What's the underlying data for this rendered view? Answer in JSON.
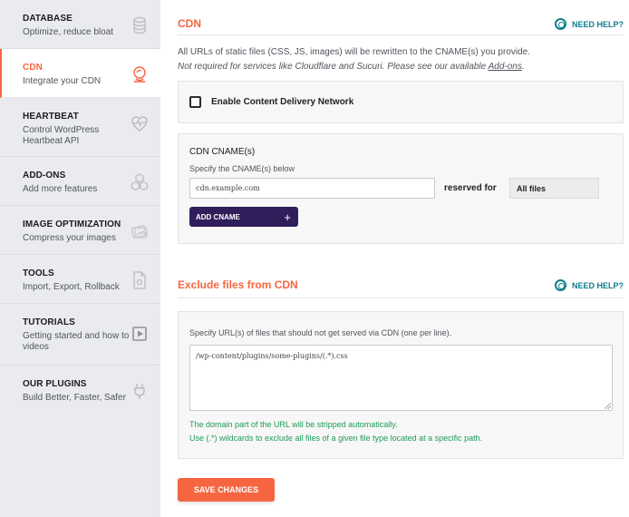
{
  "sidebar": {
    "items": [
      {
        "title": "DATABASE",
        "desc": "Optimize, reduce bloat",
        "icon": "database-icon"
      },
      {
        "title": "CDN",
        "desc": "Integrate your CDN",
        "icon": "cdn-icon"
      },
      {
        "title": "HEARTBEAT",
        "desc": "Control WordPress Heartbeat API",
        "icon": "heartbeat-icon"
      },
      {
        "title": "ADD-ONS",
        "desc": "Add more features",
        "icon": "addons-icon"
      },
      {
        "title": "IMAGE OPTIMIZATION",
        "desc": "Compress your images",
        "icon": "image-icon"
      },
      {
        "title": "TOOLS",
        "desc": "Import, Export, Rollback",
        "icon": "tools-icon"
      },
      {
        "title": "TUTORIALS",
        "desc": "Getting started and how to videos",
        "icon": "play-icon"
      },
      {
        "title": "OUR PLUGINS",
        "desc": "Build Better, Faster, Safer",
        "icon": "plug-icon"
      }
    ]
  },
  "cdn": {
    "title": "CDN",
    "help": "NEED HELP?",
    "intro_line1": "All URLs of static files (CSS, JS, images) will be rewritten to the CNAME(s) you provide.",
    "intro_line2_prefix": "Not required for services like Cloudflare and Sucuri. Please see our available ",
    "intro_link": "Add-ons",
    "intro_line2_suffix": ".",
    "enable_label": "Enable Content Delivery Network",
    "cname_title": "CDN CNAME(s)",
    "cname_sub": "Specify the CNAME(s) below",
    "cname_value": "cdn.example.com",
    "reserved_label": "reserved for",
    "reserved_option": "All files",
    "add_cname": "ADD CNAME",
    "add_plus": "+"
  },
  "exclude": {
    "title": "Exclude files from CDN",
    "help": "NEED HELP?",
    "description": "Specify URL(s) of files that should not get served via CDN (one per line).",
    "textarea_value": "/wp-content/plugins/some-plugins/(.*).css",
    "note1": "The domain part of the URL will be stripped automatically.",
    "note2": "Use (.*) wildcards to exclude all files of a given file type located at a specific path."
  },
  "save_label": "SAVE CHANGES",
  "colors": {
    "accent": "#f56640",
    "help": "#0e7f8c",
    "purple": "#2f1e5a",
    "note": "#1f9a59"
  }
}
